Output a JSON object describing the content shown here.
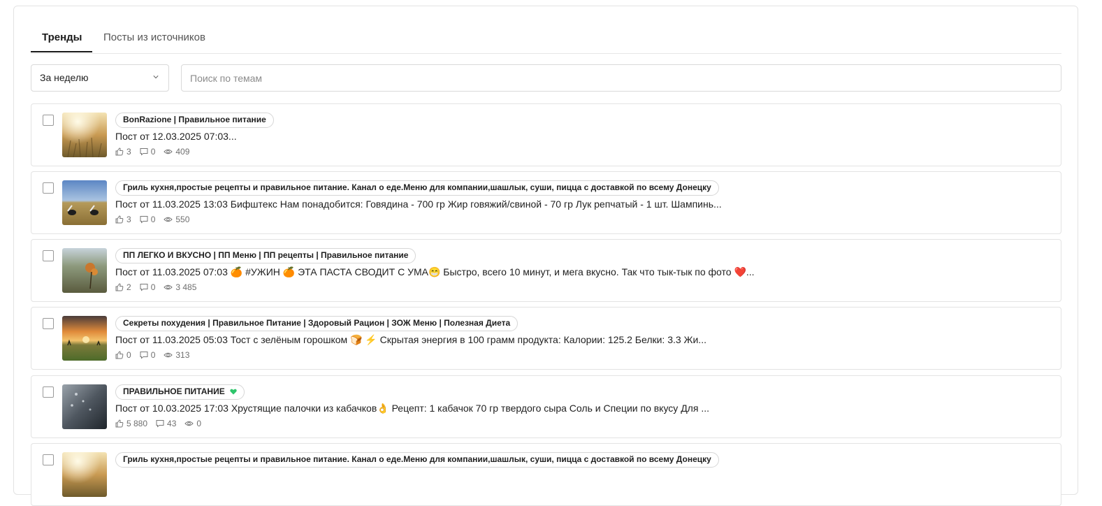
{
  "tabs": [
    {
      "label": "Тренды",
      "active": true
    },
    {
      "label": "Посты из источников",
      "active": false
    }
  ],
  "filters": {
    "period": "За неделю",
    "search_placeholder": "Поиск по темам"
  },
  "icons": {
    "like": "thumbs-up-icon",
    "comment": "comment-icon",
    "views": "eye-icon",
    "chevron": "chevron-down-icon"
  },
  "posts": [
    {
      "source": "BonRazione | Правильное питание",
      "text": "Пост от 12.03.2025 07:03...",
      "likes": "3",
      "comments": "0",
      "views": "409"
    },
    {
      "source": "Гриль кухня,простые рецепты и правильное питание. Канал о еде.Меню для компании,шашлык, суши, пицца с доставкой по всему Донецку",
      "text": "Пост от 11.03.2025 13:03 Бифштекс Нам понадобится: Говядина - 700 гр Жир говяжий/свиной - 70 гр Лук репчатый - 1 шт. Шампинь...",
      "likes": "3",
      "comments": "0",
      "views": "550"
    },
    {
      "source": "ПП ЛЕГКО И ВКУСНО | ПП Меню | ПП рецепты | Правильное питание",
      "text": "Пост от 11.03.2025 07:03 🍊 #УЖИН 🍊  ЭТА ПАСТА СВОДИТ С УМА😁 Быстро, всего 10 минут, и мега вкусно. Так что тык-тык по фото ❤️...",
      "likes": "2",
      "comments": "0",
      "views": "3 485"
    },
    {
      "source": "Секреты похудения | Правильное Питание | Здоровый Рацион | ЗОЖ Меню | Полезная Диета",
      "text": "Пост от 11.03.2025 05:03 Тост с зелёным горошком 🍞  ⚡ Скрытая энергия в 100 грамм продукта: Калории: 125.2 Белки: 3.3 Жи...",
      "likes": "0",
      "comments": "0",
      "views": "313"
    },
    {
      "source": "ПРАВИЛЬНОЕ ПИТАНИЕ",
      "text": "Пост от 10.03.2025 17:03 Хрустящие палочки из кабачков👌 Рецепт: 1 кабачок 70 гр твердого сыра Соль и Специи по вкусу Для ...",
      "likes": "5 880",
      "comments": "43",
      "views": "0"
    },
    {
      "source": "Гриль кухня,простые рецепты и правильное питание. Канал о еде.Меню для компании,шашлык, суши, пицца с доставкой по всему Донецку",
      "text": "",
      "likes": "",
      "comments": "",
      "views": ""
    }
  ]
}
